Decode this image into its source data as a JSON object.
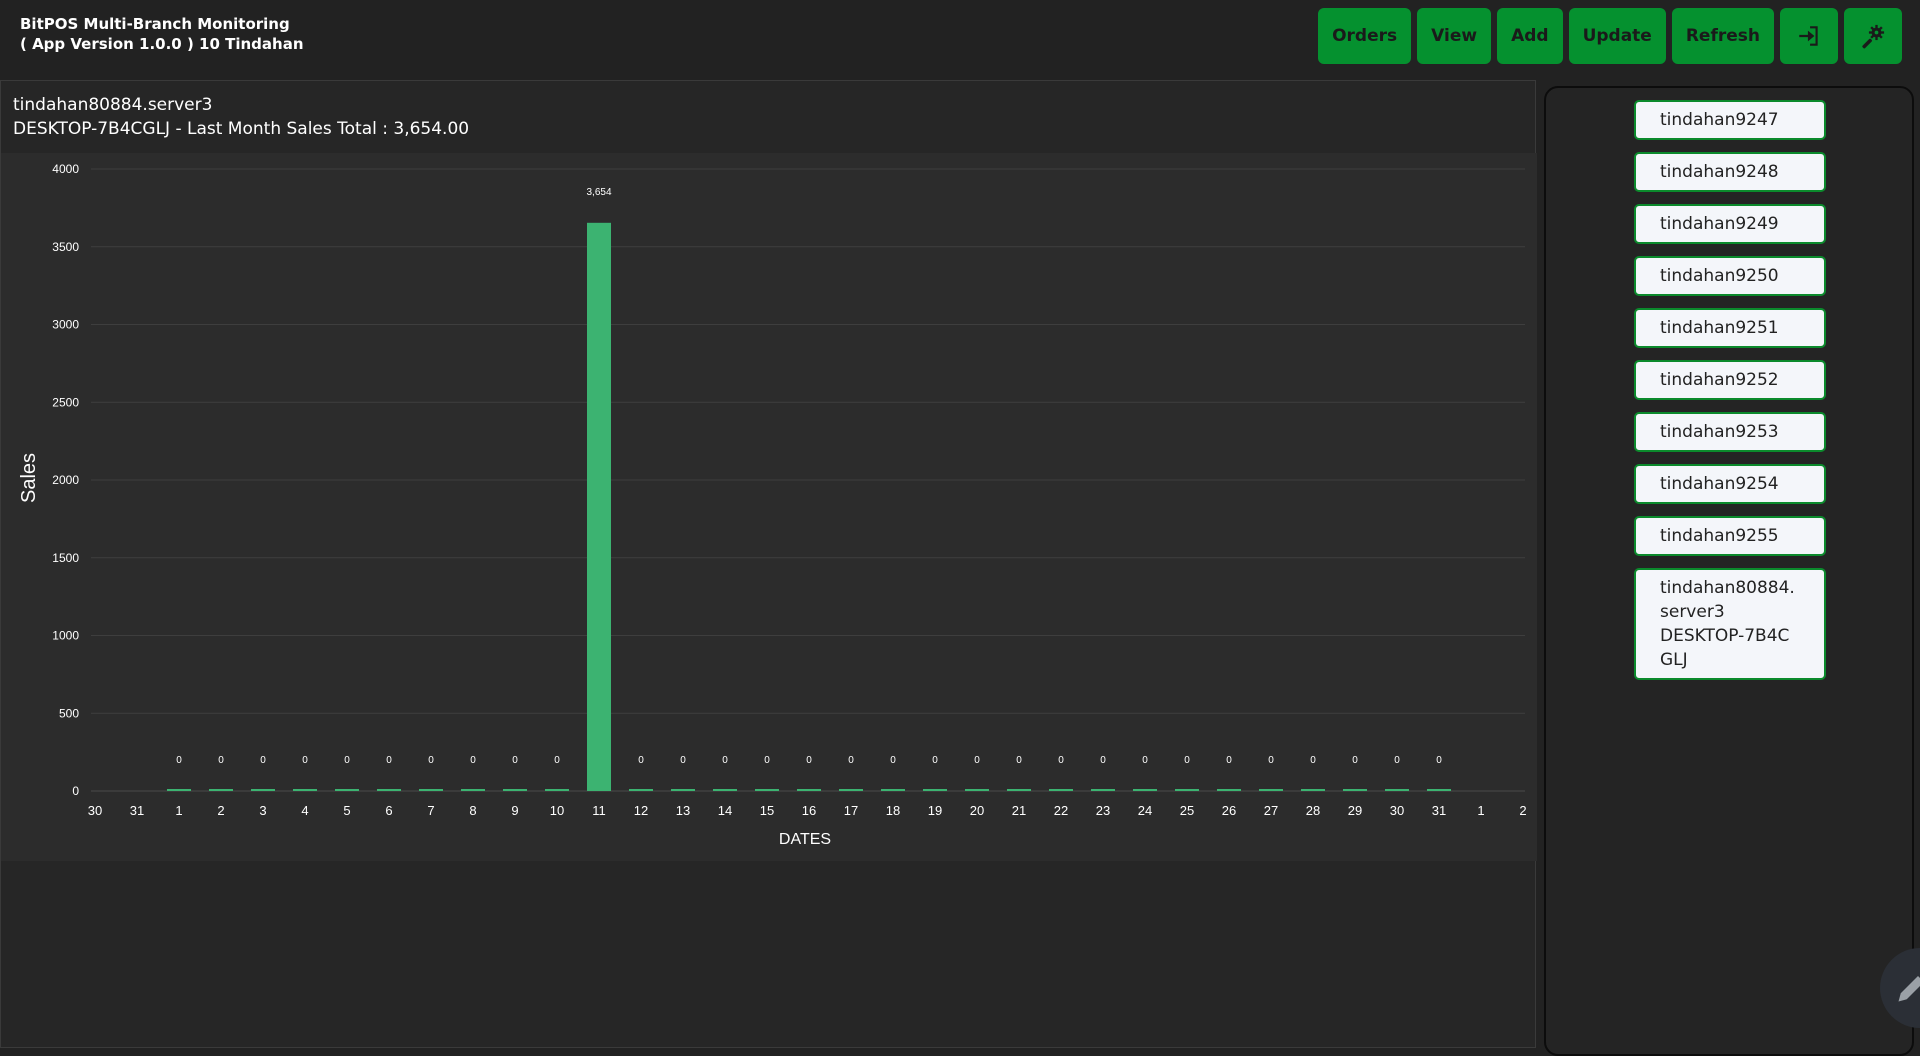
{
  "app": {
    "title_line1": "BitPOS Multi-Branch Monitoring",
    "title_line2": "( App Version 1.0.0 ) 10 Tindahan"
  },
  "toolbar": {
    "orders_label": "Orders",
    "view_label": "View",
    "add_label": "Add",
    "update_label": "Update",
    "refresh_label": "Refresh",
    "logout_icon": "logout-icon",
    "settings_icon": "gear-icon"
  },
  "panel": {
    "line1": "tindahan80884.server3",
    "line2": "DESKTOP-7B4CGLJ - Last Month Sales Total : 3,654.00"
  },
  "colors": {
    "accent": "#05912f",
    "bar": "#3cb371",
    "background": "#222222",
    "chart_background": "#2c2c2c"
  },
  "chart_data": {
    "type": "bar",
    "xlabel": "DATES",
    "ylabel": "Sales",
    "ylim": [
      0,
      4000
    ],
    "yticks": [
      0,
      500,
      1000,
      1500,
      2000,
      2500,
      3000,
      3500,
      4000
    ],
    "grid": true,
    "legend": "none",
    "categories": [
      "30",
      "31",
      "1",
      "2",
      "3",
      "4",
      "5",
      "6",
      "7",
      "8",
      "9",
      "10",
      "11",
      "12",
      "13",
      "14",
      "15",
      "16",
      "17",
      "18",
      "19",
      "20",
      "21",
      "22",
      "23",
      "24",
      "25",
      "26",
      "27",
      "28",
      "29",
      "30",
      "31",
      "1",
      "2"
    ],
    "values": [
      null,
      null,
      0,
      0,
      0,
      0,
      0,
      0,
      0,
      0,
      0,
      0,
      3654,
      0,
      0,
      0,
      0,
      0,
      0,
      0,
      0,
      0,
      0,
      0,
      0,
      0,
      0,
      0,
      0,
      0,
      0,
      0,
      0,
      null,
      null
    ],
    "labels": [
      "",
      "",
      "0",
      "0",
      "0",
      "0",
      "0",
      "0",
      "0",
      "0",
      "0",
      "0",
      "3,654",
      "0",
      "0",
      "0",
      "0",
      "0",
      "0",
      "0",
      "0",
      "0",
      "0",
      "0",
      "0",
      "0",
      "0",
      "0",
      "0",
      "0",
      "0",
      "0",
      "0",
      "",
      ""
    ]
  },
  "sidebar": {
    "branches": [
      {
        "lines": [
          "tindahan9247"
        ]
      },
      {
        "lines": [
          "tindahan9248"
        ]
      },
      {
        "lines": [
          "tindahan9249"
        ]
      },
      {
        "lines": [
          "tindahan9250"
        ]
      },
      {
        "lines": [
          "tindahan9251"
        ]
      },
      {
        "lines": [
          "tindahan9252"
        ]
      },
      {
        "lines": [
          "tindahan9253"
        ]
      },
      {
        "lines": [
          "tindahan9254"
        ]
      },
      {
        "lines": [
          "tindahan9255"
        ]
      },
      {
        "lines": [
          "tindahan80884.server3",
          "DESKTOP-7B4CGLJ"
        ]
      }
    ]
  },
  "fab": {
    "icon": "pencil-icon"
  }
}
